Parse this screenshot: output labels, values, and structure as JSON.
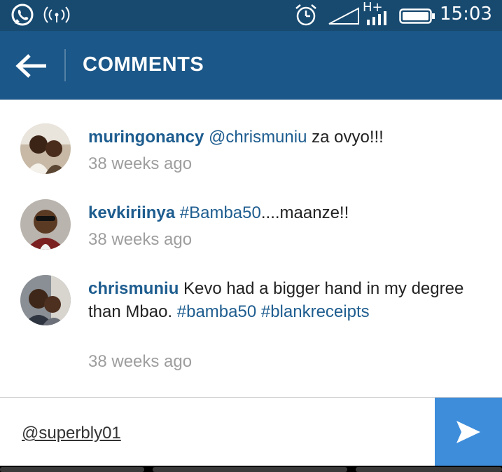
{
  "status_bar": {
    "time": "15:03",
    "network_type": "H+",
    "icons": [
      "whatsapp-icon",
      "wifi-hotspot-icon",
      "alarm-icon",
      "cell-signal-icon",
      "data-bars-icon",
      "battery-icon"
    ]
  },
  "app_bar": {
    "title": "COMMENTS",
    "back_icon": "arrow-left-icon"
  },
  "comments": [
    {
      "username": "muringonancy",
      "body_parts": [
        {
          "text": "@chrismuniu",
          "kind": "tag"
        },
        {
          "text": " za ovyo!!!",
          "kind": "plain"
        }
      ],
      "time": "38 weeks ago"
    },
    {
      "username": "kevkiriinya",
      "body_parts": [
        {
          "text": "#Bamba50",
          "kind": "tag"
        },
        {
          "text": "....maanze!!",
          "kind": "plain"
        }
      ],
      "time": "38 weeks ago"
    },
    {
      "username": "chrismuniu",
      "body_parts": [
        {
          "text": "Kevo had a bigger hand in my degree than Mbao.  ",
          "kind": "plain"
        },
        {
          "text": "#bamba50",
          "kind": "tag"
        },
        {
          "text": " ",
          "kind": "plain"
        },
        {
          "text": "#blankreceipts",
          "kind": "tag"
        }
      ],
      "time": "38 weeks ago"
    }
  ],
  "composer": {
    "value": "@superbly01",
    "send_icon": "send-icon"
  },
  "colors": {
    "status_bar": "#184a70",
    "app_bar": "#1b5788",
    "link": "#1e5d8f",
    "timestamp": "#9e9e9e",
    "send_button": "#3d8ddb"
  }
}
